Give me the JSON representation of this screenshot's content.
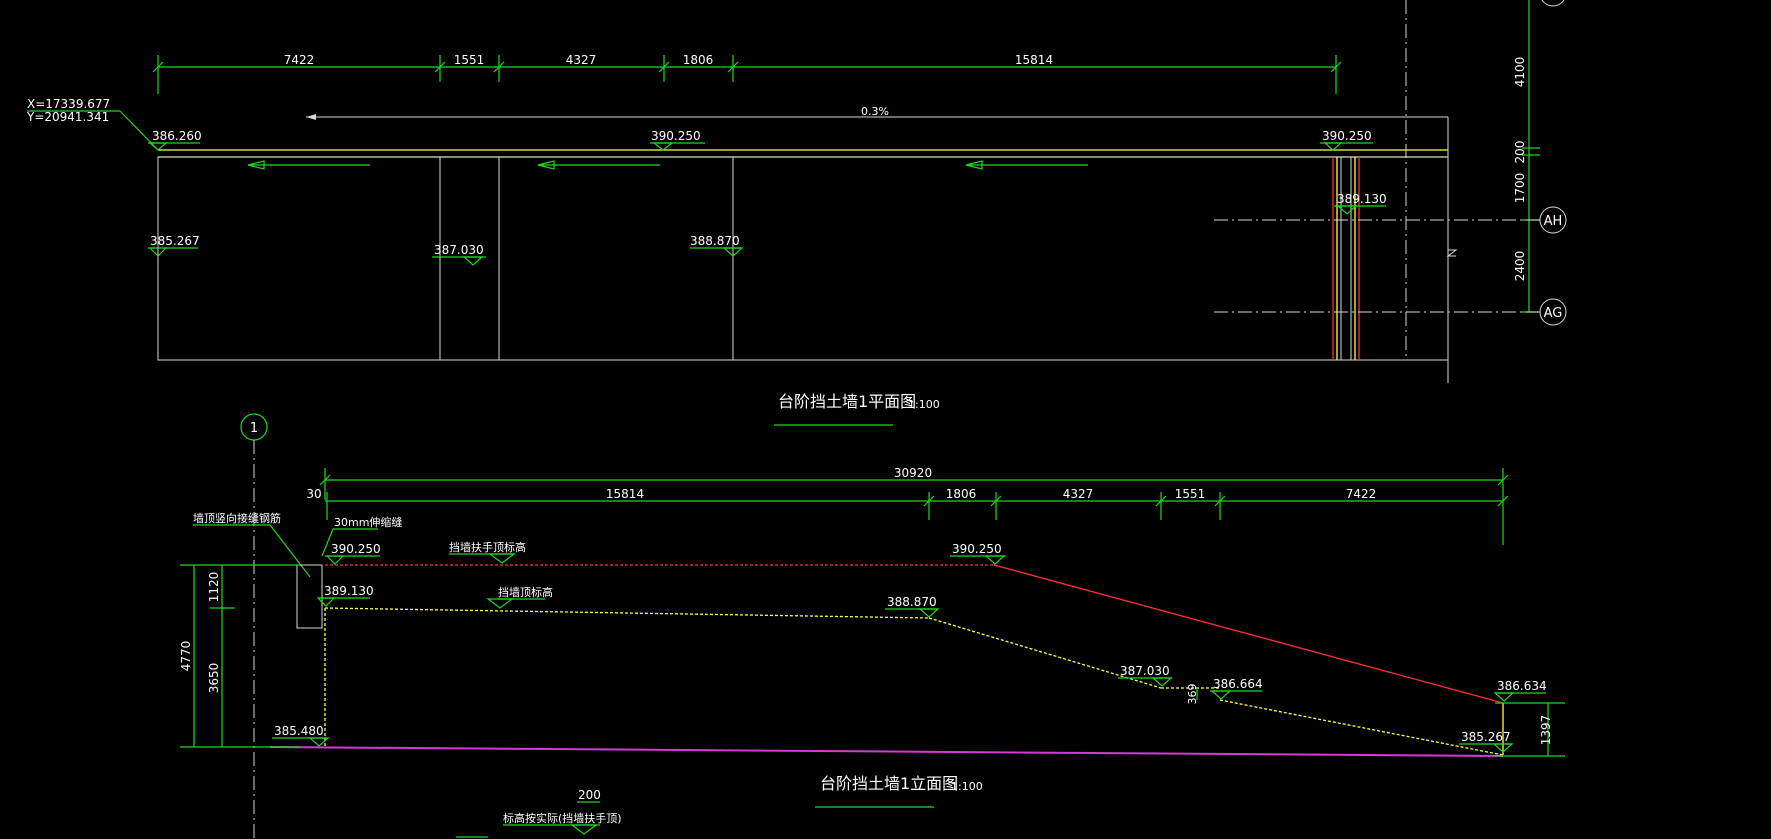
{
  "colors": {
    "background": "#000000",
    "dimension": "#1fd81f",
    "outline": "#d8d8d8",
    "wall_top": "#ffff4d",
    "handrail": "#ff3030",
    "ground": "#d43ad4",
    "text": "#ffffff"
  },
  "plan": {
    "dims": [
      "7422",
      "1551",
      "4327",
      "1806",
      "15814"
    ],
    "coord_x": "X=17339.677",
    "coord_y": "Y=20941.341",
    "slope": "0.3%",
    "elev_top": [
      "386.260",
      "390.250",
      "390.250"
    ],
    "elev_inner": [
      "385.267",
      "387.030",
      "388.870",
      "389.130"
    ],
    "right_dims": [
      "4100",
      "200",
      "1700",
      "2400"
    ],
    "axis_labels": [
      "AH",
      "AG"
    ],
    "title": "台阶挡土墙1平面图",
    "scale": "1:100"
  },
  "elevation": {
    "axis_label": "1",
    "total_dim": "30920",
    "dims": [
      "30",
      "15814",
      "1806",
      "4327",
      "1551",
      "7422"
    ],
    "note_left": "墙顶竖向接缝钢筋",
    "note_joint": "30mm伸缩缝",
    "note_handrail": "挡墙扶手顶标高",
    "note_walltop": "挡墙顶标高",
    "elev": [
      "390.250",
      "389.130",
      "390.250",
      "388.870",
      "387.030",
      "386.664",
      "386.634",
      "385.267",
      "385.480"
    ],
    "left_dims": [
      "1120",
      "4770",
      "3650"
    ],
    "right_dims": [
      "1397",
      "369"
    ],
    "title": "台阶挡土墙1立面图",
    "scale": "1:100",
    "bottom_dim": "200",
    "bottom_note": "标高按实际(挡墙扶手顶)"
  }
}
